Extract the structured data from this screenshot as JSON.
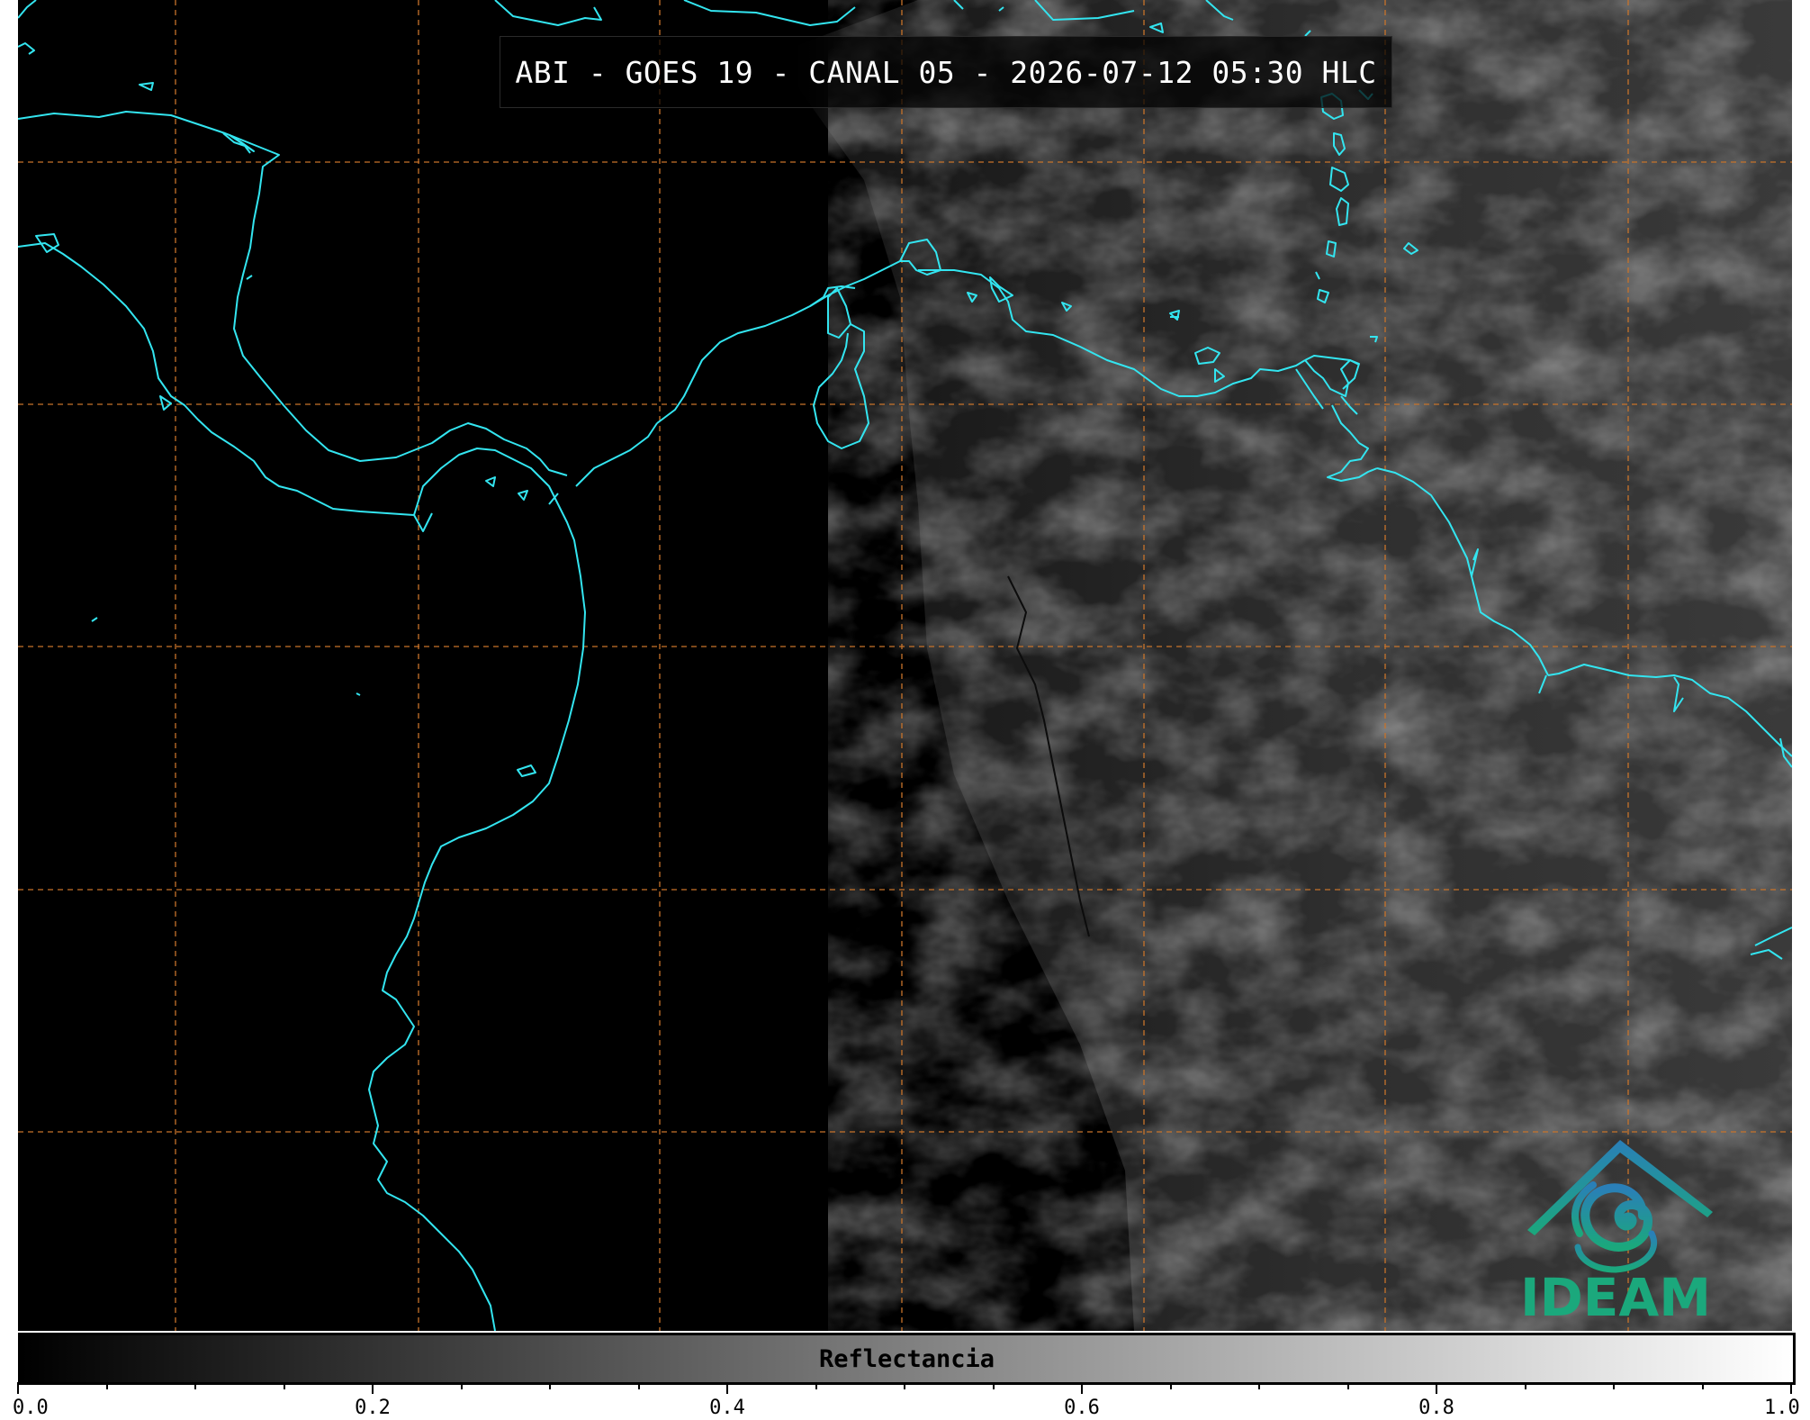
{
  "title": "ABI - GOES 19 - CANAL 05 - 2026-07-12 05:30 HLC",
  "colorbar": {
    "label": "Reflectancia",
    "ticks": [
      "0.0",
      "0.2",
      "0.4",
      "0.6",
      "0.8",
      "1.0"
    ],
    "min": 0.0,
    "max": 1.0
  },
  "logo": {
    "text": "IDEAM"
  },
  "colors": {
    "coastline": "#33e5f0",
    "gridlines": "#c8732a",
    "logo_blue": "#2a7fb8",
    "logo_green": "#1ba87c"
  }
}
